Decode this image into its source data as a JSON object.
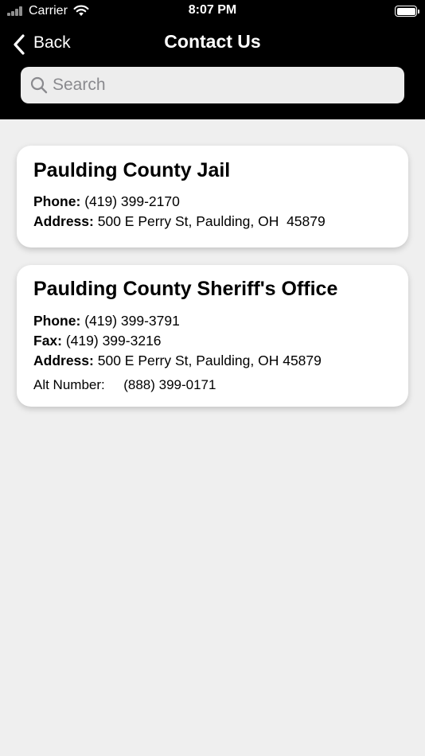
{
  "status_bar": {
    "carrier": "Carrier",
    "time": "8:07 PM"
  },
  "nav": {
    "back_label": "Back",
    "title": "Contact Us"
  },
  "search": {
    "placeholder": "Search",
    "value": ""
  },
  "contacts": [
    {
      "name": "Paulding County Jail",
      "phone_label": "Phone:",
      "phone": "(419) 399-2170",
      "address_label": "Address:",
      "address": "500 E Perry St, Paulding, OH  45879"
    },
    {
      "name": "Paulding County Sheriff's Office",
      "phone_label": "Phone:",
      "phone": "(419) 399-3791",
      "fax_label": "Fax:",
      "fax": "(419) 399-3216",
      "address_label": "Address:",
      "address": "500 E Perry St, Paulding, OH 45879",
      "alt_label": "Alt Number:",
      "alt_number": "(888) 399-0171"
    }
  ],
  "colors": {
    "header_bg": "#000000",
    "page_bg": "#efefef",
    "card_bg": "#ffffff",
    "search_bg": "#ededed",
    "placeholder": "#8a8a8e"
  },
  "icons": [
    "signal-icon",
    "wifi-icon",
    "battery-icon",
    "chevron-left-icon",
    "search-icon"
  ]
}
